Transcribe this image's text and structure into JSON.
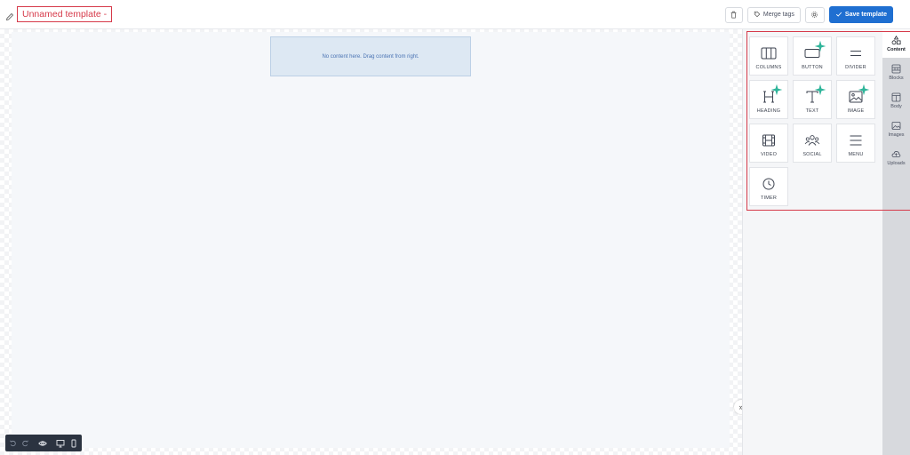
{
  "header": {
    "template_title": "Unnamed template -",
    "merge_tags_label": "Merge tags",
    "save_label": "Save template",
    "icons": {
      "edit": "pencil-icon",
      "delete": "trash-icon",
      "merge": "tag-icon",
      "settings": "gear-icon",
      "save": "check-icon"
    }
  },
  "canvas": {
    "dropzone_text": "No content here. Drag content from right."
  },
  "content_tools": [
    {
      "label": "COLUMNS",
      "icon": "columns-icon",
      "ai": false
    },
    {
      "label": "BUTTON",
      "icon": "button-icon",
      "ai": true
    },
    {
      "label": "DIVIDER",
      "icon": "divider-icon",
      "ai": false
    },
    {
      "label": "HEADING",
      "icon": "heading-icon",
      "ai": true
    },
    {
      "label": "TEXT",
      "icon": "text-icon",
      "ai": true
    },
    {
      "label": "IMAGE",
      "icon": "image-icon",
      "ai": true
    },
    {
      "label": "VIDEO",
      "icon": "video-icon",
      "ai": false
    },
    {
      "label": "SOCIAL",
      "icon": "social-icon",
      "ai": false
    },
    {
      "label": "MENU",
      "icon": "menu-icon",
      "ai": false
    },
    {
      "label": "TIMER",
      "icon": "timer-icon",
      "ai": false
    }
  ],
  "side_tabs": [
    {
      "label": "Content",
      "icon": "shapes-icon",
      "active": true
    },
    {
      "label": "Blocks",
      "icon": "blocks-icon",
      "active": false
    },
    {
      "label": "Body",
      "icon": "body-icon",
      "active": false
    },
    {
      "label": "Images",
      "icon": "images-icon",
      "active": false
    },
    {
      "label": "Uploads",
      "icon": "cloud-upload-icon",
      "active": false
    }
  ],
  "bottom_toolbar": {
    "icons": [
      "undo-icon",
      "redo-icon",
      "preview-eye-icon",
      "desktop-icon",
      "mobile-icon"
    ]
  },
  "colors": {
    "accent": "#1f6fd1",
    "highlight": "#d63a4a",
    "ai_badge": "#2fb59a"
  }
}
